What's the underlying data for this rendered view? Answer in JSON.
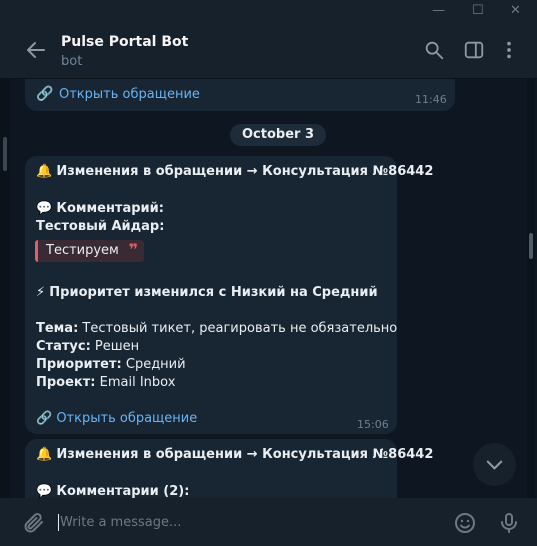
{
  "window": {
    "minimize": "—",
    "maximize": "☐",
    "close": "✕"
  },
  "header": {
    "title": "Pulse Portal Bot",
    "subtitle": "bot"
  },
  "icons": {
    "back": "back-arrow-icon",
    "search": "search-icon",
    "sidebar": "sidebar-toggle-icon",
    "menu": "more-vertical-icon",
    "attach": "paperclip-icon",
    "emoji": "emoji-icon",
    "mic": "microphone-icon",
    "scroll_down": "chevron-down-icon"
  },
  "messages": [
    {
      "link_text": "Открыть обращение",
      "time": "11:46"
    },
    {
      "date": "October 3"
    },
    {
      "line1": "Изменения в обращении → Консультация №86442",
      "comment_label": "Комментарий:",
      "author": "Тестовый Айдар:",
      "quote": "Тестируем",
      "priority": "Приоритет изменился с Низкий на Средний",
      "topic_label": "Тема:",
      "topic_value": " Тестовый тикет, реагировать не обязательно",
      "status_label": "Статус:",
      "status_value": " Решен",
      "prio_label": "Приоритет:",
      "prio_value": " Средний",
      "project_label": "Проект:",
      "project_value": " Email Inbox",
      "link_text": "Открыть обращение",
      "time": "15:06"
    },
    {
      "line1": "Изменения в обращении → Консультация №86442",
      "comment_label": "Комментарии (2):"
    }
  ],
  "composer": {
    "placeholder": "Write a message..."
  },
  "colors": {
    "background": "#0e1621",
    "bubble": "#182533",
    "link": "#6ab3f3",
    "quote_accent": "#e05d6a"
  }
}
